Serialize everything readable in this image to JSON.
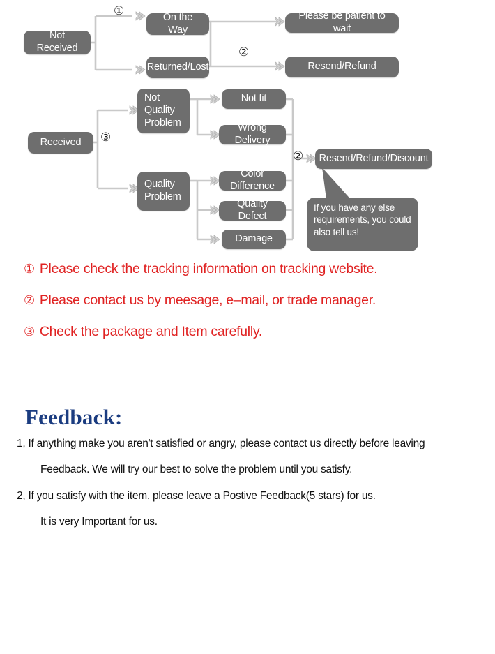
{
  "flowchart": {
    "nodes": {
      "not_received": "Not Received",
      "on_the_way": "On the Way",
      "returned_lost": "Returned/Lost",
      "please_wait": "Please be patient to wait",
      "resend_refund": "Resend/Refund",
      "received": "Received",
      "not_quality_problem": "Not\nQuality\nProblem",
      "quality_problem": "Quality\nProblem",
      "not_fit": "Not fit",
      "wrong_delivery": "Wrong Delivery",
      "color_difference": "Color Difference",
      "quality_defect": "Quality Defect",
      "damage": "Damage",
      "resend_refund_discount": "Resend/Refund/Discount"
    },
    "markers": {
      "m1": "①",
      "m2_top": "②",
      "m3": "③",
      "m2_bottom": "②"
    },
    "callout": "If you have any else requirements, you could also tell us!",
    "colors": {
      "node_fill": "#6e6e6e",
      "node_text": "#ffffff",
      "connector": "#c8c8c8"
    }
  },
  "notes": [
    {
      "num": "①",
      "text": "Please check the tracking information on tracking website."
    },
    {
      "num": "②",
      "text": "Please contact us by meesage, e–mail, or trade manager."
    },
    {
      "num": "③",
      "text": "Check the package and Item carefully."
    }
  ],
  "feedback": {
    "title": "Feedback:",
    "lines": [
      "1, If anything make you aren't satisfied or angry, please contact us directly before leaving",
      "Feedback. We will try our best to solve the problem until you satisfy.",
      "2, If you satisfy with the item, please leave a Postive Feedback(5 stars) for us.",
      "It is very Important for us."
    ]
  },
  "colors": {
    "red": "#e02222",
    "navy": "#1b3c80",
    "gray": "#6e6e6e"
  }
}
